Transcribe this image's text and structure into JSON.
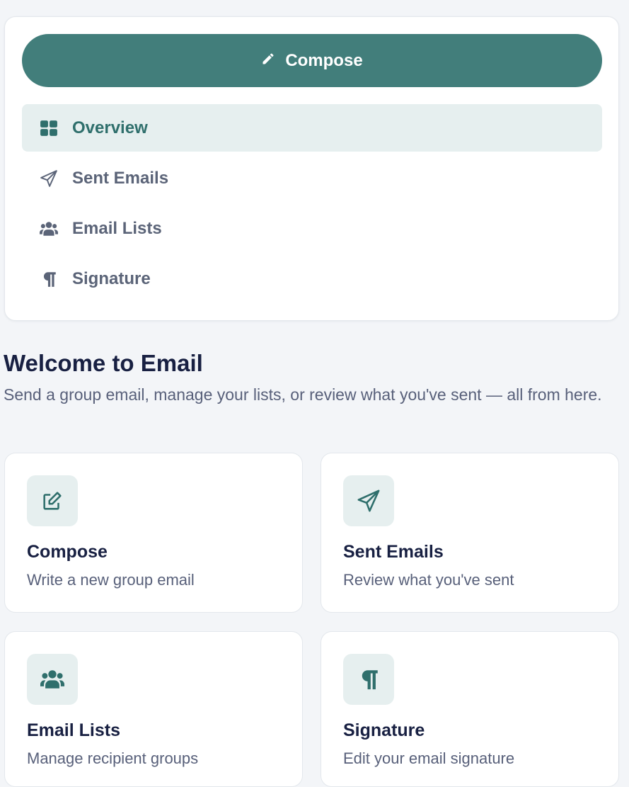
{
  "sidebar": {
    "compose": {
      "label": "Compose",
      "icon": "pencil-icon"
    },
    "items": [
      {
        "label": "Overview",
        "icon": "grid-icon",
        "active": true
      },
      {
        "label": "Sent Emails",
        "icon": "paper-plane-icon",
        "active": false
      },
      {
        "label": "Email Lists",
        "icon": "users-icon",
        "active": false
      },
      {
        "label": "Signature",
        "icon": "paragraph-icon",
        "active": false
      }
    ]
  },
  "main": {
    "title": "Welcome to Email",
    "subtitle": "Send a group email, manage your lists, or review what you've sent — all from here.",
    "tiles": [
      {
        "title": "Compose",
        "description": "Write a new group email",
        "icon": "edit-icon"
      },
      {
        "title": "Sent Emails",
        "description": "Review what you've sent",
        "icon": "paper-plane-icon"
      },
      {
        "title": "Email Lists",
        "description": "Manage recipient groups",
        "icon": "users-icon"
      },
      {
        "title": "Signature",
        "description": "Edit your email signature",
        "icon": "paragraph-icon"
      }
    ]
  },
  "colors": {
    "accent": "#427e7b",
    "accent_light": "#e6efef",
    "heading": "#182042",
    "muted": "#58607a",
    "background": "#f3f5f8"
  }
}
